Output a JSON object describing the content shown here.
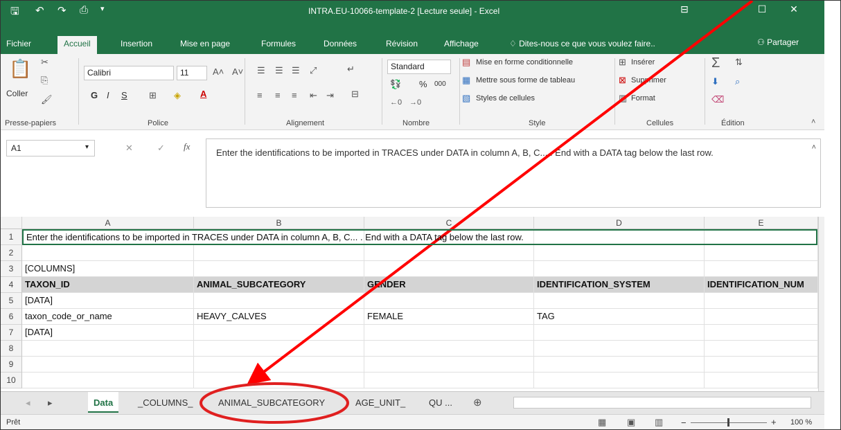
{
  "titlebar": {
    "title": "INTRA.EU-10066-template-2  [Lecture seule] - Excel",
    "save_icon": "save-icon",
    "undo_icon": "undo-icon",
    "redo_icon": "redo-icon"
  },
  "ribbon_tabs": [
    "Fichier",
    "Accueil",
    "Insertion",
    "Mise en page",
    "Formules",
    "Données",
    "Révision",
    "Affichage"
  ],
  "tell_me": "Dites-nous ce que vous voulez faire..",
  "share_label": "Partager",
  "ribbon": {
    "paste_label": "Coller",
    "font_name": "Calibri",
    "font_size": "11",
    "bold": "G",
    "italic": "I",
    "underline": "S",
    "number_format": "Standard",
    "percent": "%",
    "thousands": "000",
    "cond_format": "Mise en forme conditionnelle",
    "format_table": "Mettre sous forme de tableau",
    "cell_styles": "Styles de cellules",
    "insert": "Insérer",
    "delete": "Supprimer",
    "format": "Format",
    "groups": [
      "Presse-papiers",
      "Police",
      "Alignement",
      "Nombre",
      "Style",
      "Cellules",
      "Édition"
    ]
  },
  "formula_bar": {
    "name_box": "A1",
    "fx": "fx",
    "content": "Enter the identifications to be imported in TRACES under  DATA in column A, B, C... . End with a DATA tag below the last row."
  },
  "grid": {
    "columns": [
      "A",
      "B",
      "C",
      "D",
      "E"
    ],
    "rows": [
      {
        "num": "1",
        "cells": [
          "Enter the identifications to be imported in TRACES under  DATA in column A, B, C... . End with a DATA tag below the last row.",
          "",
          "",
          "",
          ""
        ]
      },
      {
        "num": "2",
        "cells": [
          "",
          "",
          "",
          "",
          ""
        ]
      },
      {
        "num": "3",
        "cells": [
          "[COLUMNS]",
          "",
          "",
          "",
          ""
        ]
      },
      {
        "num": "4",
        "cells": [
          "TAXON_ID",
          "ANIMAL_SUBCATEGORY",
          "GENDER",
          "IDENTIFICATION_SYSTEM",
          "IDENTIFICATION_NUM"
        ]
      },
      {
        "num": "5",
        "cells": [
          "[DATA]",
          "",
          "",
          "",
          ""
        ]
      },
      {
        "num": "6",
        "cells": [
          "taxon_code_or_name",
          "HEAVY_CALVES",
          "FEMALE",
          "TAG",
          ""
        ]
      },
      {
        "num": "7",
        "cells": [
          "[DATA]",
          "",
          "",
          "",
          ""
        ]
      },
      {
        "num": "8",
        "cells": [
          "",
          "",
          "",
          "",
          ""
        ]
      },
      {
        "num": "9",
        "cells": [
          "",
          "",
          "",
          "",
          ""
        ]
      },
      {
        "num": "10",
        "cells": [
          "",
          "",
          "",
          "",
          ""
        ]
      }
    ]
  },
  "sheet_tabs": [
    "Data",
    "_COLUMNS_",
    "ANIMAL_SUBCATEGORY",
    "AGE_UNIT_",
    "QU ..."
  ],
  "status": {
    "ready": "Prêt",
    "zoom": "100 %"
  },
  "annotation": {
    "arrow_color": "#ff0000",
    "highlighted_tab": "ANIMAL_SUBCATEGORY"
  }
}
